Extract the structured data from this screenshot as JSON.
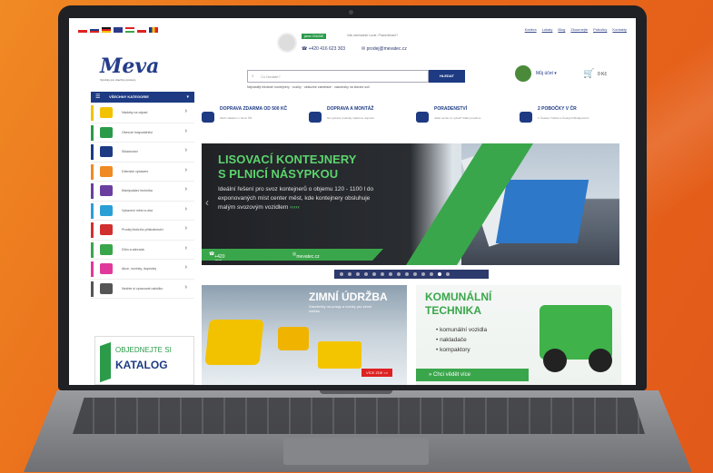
{
  "colors": {
    "brand": "#1d3a83",
    "green": "#3aa64b",
    "background": "#e96a1a"
  },
  "header": {
    "online_badge": "jsme ONLINE",
    "help_text": "Váš obchodník Lucie, Práva tlmaní?",
    "phone": "+420 416 623 303",
    "email": "prodej@mevatec.cz",
    "top_links": [
      "Kariéra",
      "Lokaty",
      "Blog",
      "Zkoumejte",
      "Pobočky",
      "Kontakty"
    ],
    "logo": "Meva",
    "logo_sub": "Výrobky pro všechny prostory",
    "search_placeholder": "Co hledáte?",
    "search_button": "HLEDAT",
    "popular": "Nejčastěji hledané: kontejnery · vozíky · obslužné zametače · zásobníky na sbírání soli",
    "account": "Můj účet",
    "cart_value": "0 Kč"
  },
  "categories": {
    "title": "VŠECHNY KATEGORIE",
    "items": [
      {
        "label": "Nádoby na odpad",
        "color": "#f2c200"
      },
      {
        "label": "Obecné hospodářství",
        "color": "#2b9b4a"
      },
      {
        "label": "Skladování",
        "color": "#1d3a83"
      },
      {
        "label": "Dílenské vybavení",
        "color": "#f08a24"
      },
      {
        "label": "Manipulační technika",
        "color": "#6b3fa0"
      },
      {
        "label": "Vybavení měst a obcí",
        "color": "#2a9fd6"
      },
      {
        "label": "Prodej čistícího příslušenství",
        "color": "#d22f2f"
      },
      {
        "label": "Dům a zahrada",
        "color": "#3aa64b"
      },
      {
        "label": "Akce, novinky, doprodej",
        "color": "#e0399b"
      },
      {
        "label": "Nechte si zpracovat nabídku",
        "color": "#555555"
      }
    ],
    "catalog_line1": "OBJEDNEJTE SI",
    "catalog_line2": "KATALOG"
  },
  "features": [
    {
      "title": "DOPRAVA ZDARMA OD 500 KČ",
      "desc": "Zboží skladem v rámci ČR"
    },
    {
      "title": "DOPRAVA A MONTÁŽ",
      "desc": "Na vybrané produkty zajistíme dopravu"
    },
    {
      "title": "PORADENSTVÍ",
      "desc": "Ještě nevíte co vybrat? Rádi poradíme"
    },
    {
      "title": "2 POBOČKY V ČR",
      "desc": "V Českém Těšíně a Českých Budějovicích"
    }
  ],
  "hero": {
    "title_line1": "LISOVACÍ KONTEJNERY",
    "title_line2": "S PLNICÍ NÁSYPKOU",
    "text": "Ideální řešení pro svoz kontejnerů o objemu 120 - 1100 l do exponovaných míst center měst, kde kontejnery obsluhuje malým svozovým vozidlem",
    "arrows": "‹‹‹‹‹",
    "phone": "+420 736 777 650",
    "web": "mevatec.cz",
    "dots_total": 14,
    "dots_active": 12
  },
  "banner_winter": {
    "title": "ZIMNÍ ÚDRŽBA",
    "subtitle": "Zásobníky na posyp a vozíky pro zimní údržbu",
    "button": "VÍCE ZDE >>"
  },
  "banner_municipal": {
    "title_line1": "KOMUNÁLNÍ",
    "title_line2": "TECHNIKA",
    "items": [
      "• komunální vozidla",
      "• nakladače",
      "• kompaktory"
    ],
    "button": "» Chci vědět více"
  }
}
